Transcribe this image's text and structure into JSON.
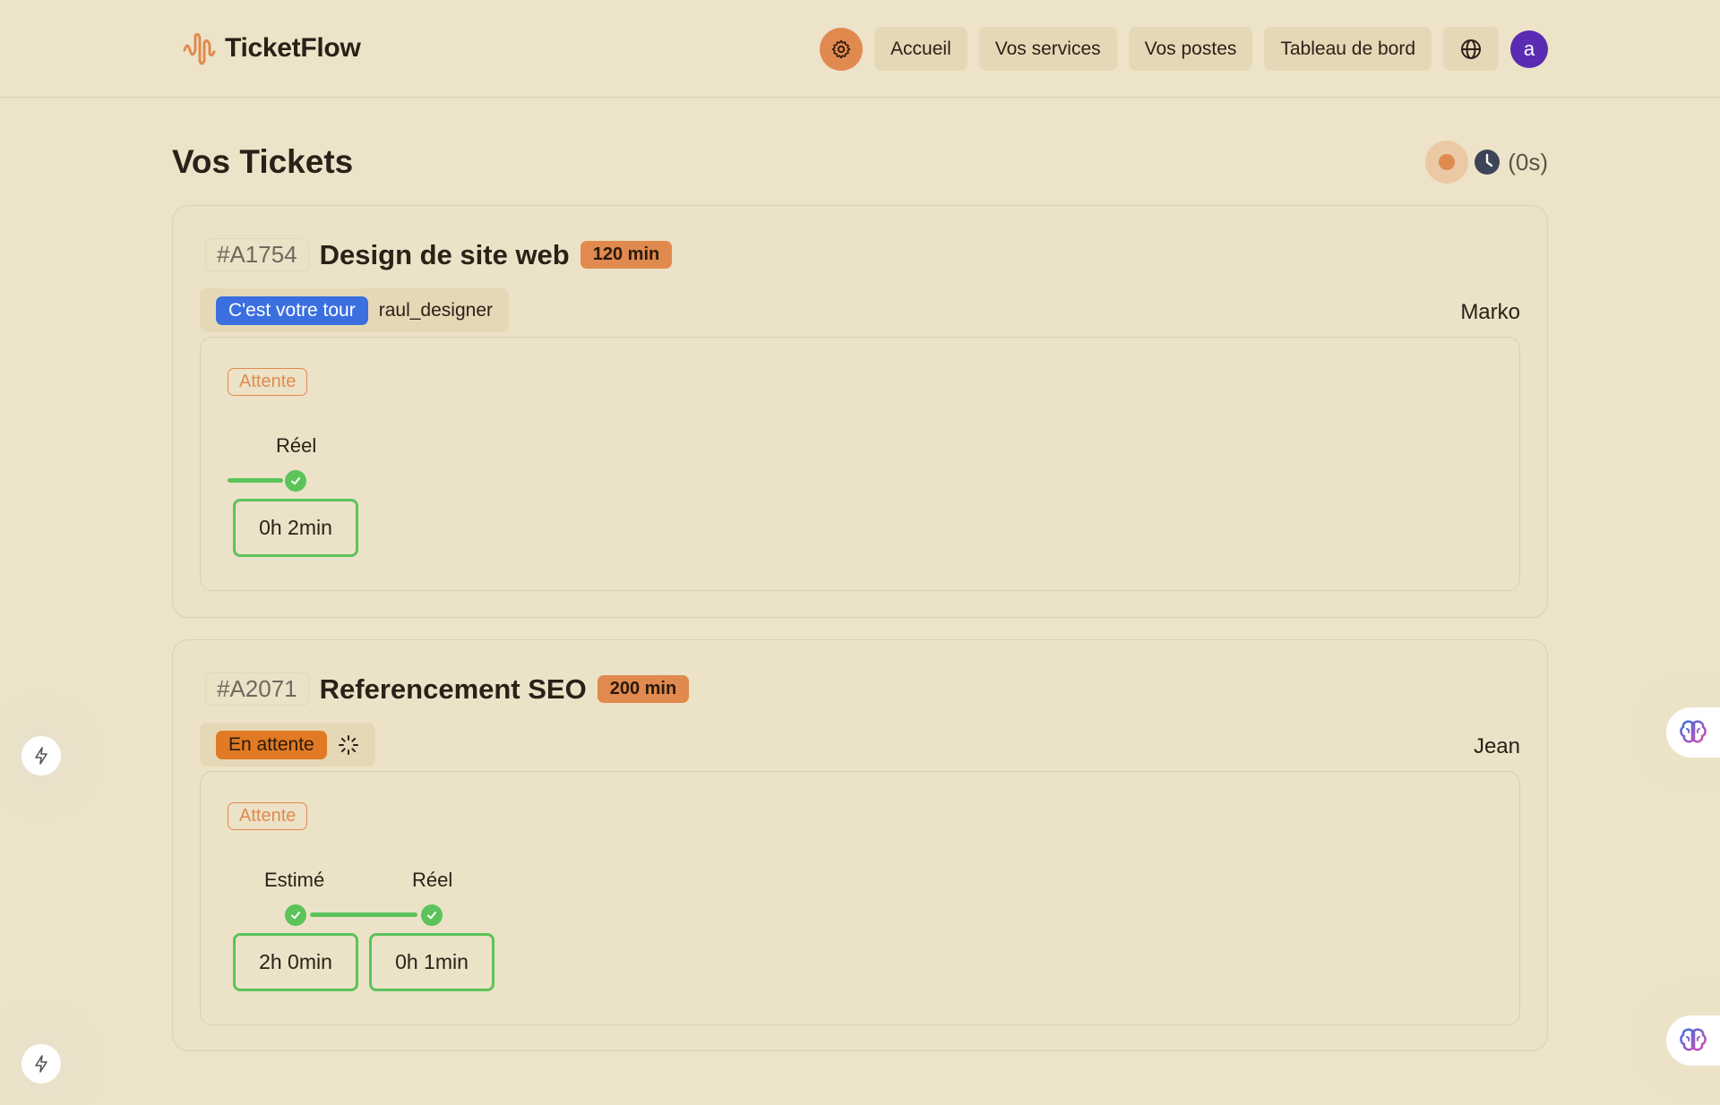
{
  "header": {
    "brand": "TicketFlow",
    "nav": [
      "Accueil",
      "Vos services",
      "Vos postes",
      "Tableau de bord"
    ],
    "avatar_initial": "a"
  },
  "page": {
    "title": "Vos Tickets",
    "timer": "(0s)"
  },
  "tickets": [
    {
      "id": "#A1754",
      "title": "Design de site web",
      "duration": "120 min",
      "status": "C'est votre tour",
      "status_user": "raul_designer",
      "assignee": "Marko",
      "state": "Attente",
      "steps": [
        {
          "label": "Réel",
          "value": "0h 2min"
        }
      ]
    },
    {
      "id": "#A2071",
      "title": "Referencement SEO",
      "duration": "200 min",
      "status": "En attente",
      "assignee": "Jean",
      "state": "Attente",
      "steps": [
        {
          "label": "Estimé",
          "value": "2h 0min"
        },
        {
          "label": "Réel",
          "value": "0h 1min"
        }
      ]
    }
  ],
  "colors": {
    "background": "#ede3c9",
    "accent": "#e08a4f",
    "success": "#5cc35a",
    "turn_badge": "#3b6fe0",
    "waiting_badge": "#e07a24",
    "avatar": "#5b2cb3"
  }
}
